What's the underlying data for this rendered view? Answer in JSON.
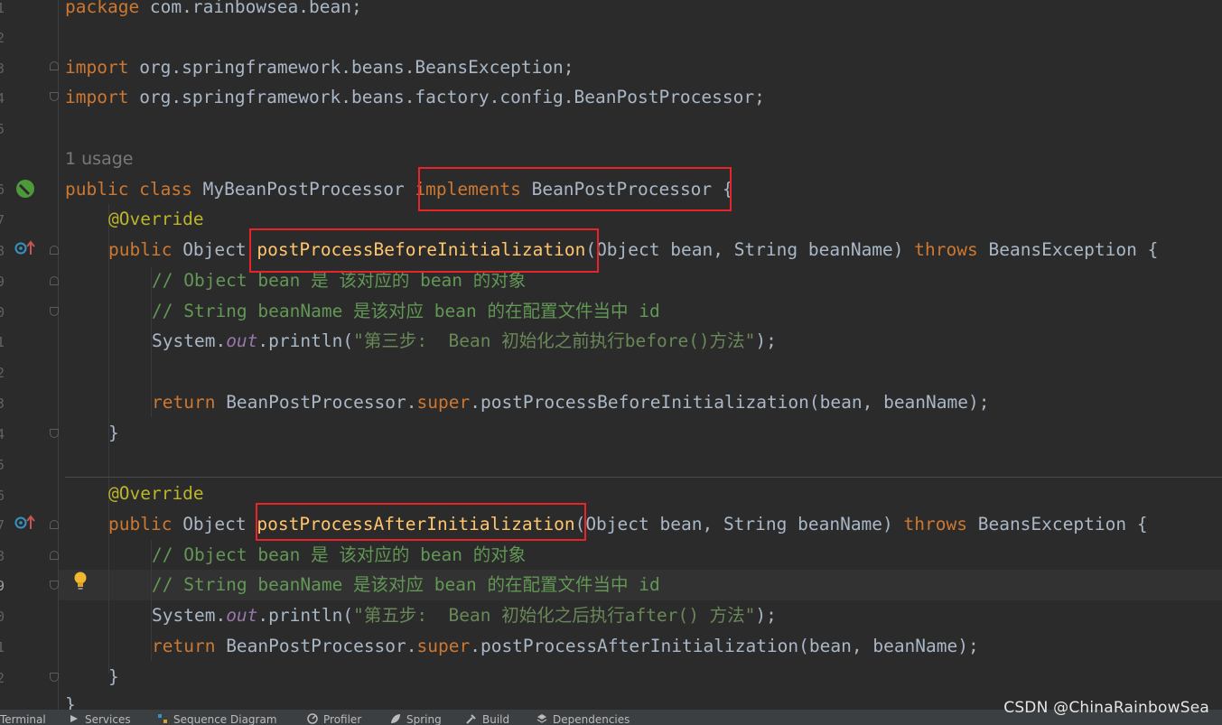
{
  "editor": {
    "line_numbers": [
      "1",
      "2",
      "3",
      "4",
      "5",
      "6",
      "7",
      "8",
      "9",
      "0",
      "1",
      "2",
      "3",
      "4",
      "5",
      "6",
      "7",
      "8",
      "9",
      "0",
      "1",
      "2"
    ],
    "usage_hint": "1 usage",
    "code": {
      "l1": {
        "kw": "package",
        "rest": " com.rainbowsea.bean;"
      },
      "l3": {
        "kw": "import",
        "rest": " org.springframework.beans.BeansException;"
      },
      "l4": {
        "kw": "import",
        "rest": " org.springframework.beans.factory.config.BeanPostProcessor;"
      },
      "l6": {
        "kw1": "public class",
        "name": " MyBeanPostProcessor ",
        "kw2": "implements",
        "iface": " BeanPostProcessor",
        "brace": " {"
      },
      "l7": {
        "annotation": "@Override"
      },
      "l8": {
        "kw": "public",
        "type": " Object ",
        "method": "postProcessBeforeInitialization",
        "params": "(Object bean, String beanName) ",
        "throws": "throws",
        "ex": " BeansException {"
      },
      "l9": {
        "comment": "// Object bean 是 该对应的 bean 的对象"
      },
      "l10": {
        "comment": "// String beanName 是该对应 bean 的在配置文件当中 id"
      },
      "l11": {
        "pre": "System.",
        "field": "out",
        "call": ".println(",
        "str": "\"第三步:  Bean 初始化之前执行before()方法\"",
        "end": ");"
      },
      "l13": {
        "kw": "return",
        "pre": " BeanPostProcessor.",
        "sup": "super",
        "rest": ".postProcessBeforeInitialization(bean, beanName);"
      },
      "l14": {
        "brace": "}"
      },
      "l16": {
        "annotation": "@Override"
      },
      "l17": {
        "kw": "public",
        "type": " Object ",
        "method": "postProcessAfterInitialization",
        "params": "(Object bean, String beanName) ",
        "throws": "throws",
        "ex": " BeansException {"
      },
      "l18": {
        "comment": "// Object bean 是 该对应的 bean 的对象"
      },
      "l19": {
        "comment": "// String beanName 是该对应 bean 的在配置文件当中 id"
      },
      "l20": {
        "pre": "System.",
        "field": "out",
        "call": ".println(",
        "str": "\"第五步:  Bean 初始化之后执行after() 方法\"",
        "end": ");"
      },
      "l21": {
        "kw": "return",
        "pre": " BeanPostProcessor.",
        "sup": "super",
        "rest": ".postProcessAfterInitialization(bean, beanName);"
      },
      "l22": {
        "brace": "}"
      },
      "l23": {
        "brace": "}"
      }
    }
  },
  "gutter_icons": [
    "bean-icon",
    "override-icon",
    "override-icon",
    "bulb-icon"
  ],
  "toolwindows": {
    "terminal": "Terminal",
    "services": "Services",
    "sequence": "Sequence Diagram",
    "profiler": "Profiler",
    "spring": "Spring",
    "build": "Build",
    "dependencies": "Dependencies"
  },
  "watermark": "CSDN @ChinaRainbowSea",
  "colors": {
    "background": "#2b2b2b",
    "keyword": "#cc7832",
    "annotation": "#bbb529",
    "comment": "#629755",
    "highlight_box": "#e8232a"
  }
}
